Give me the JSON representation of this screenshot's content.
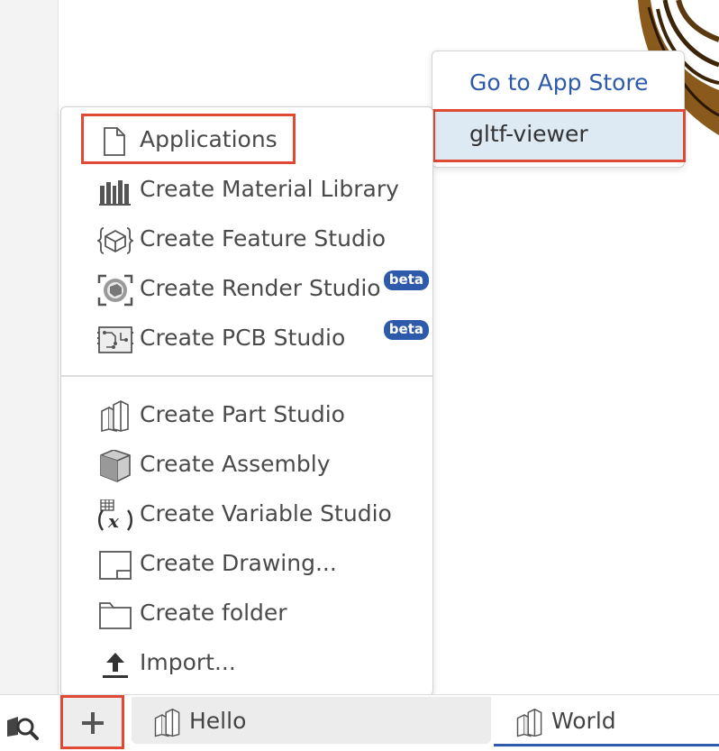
{
  "insert_menu": {
    "items": [
      {
        "label": "Applications",
        "icon": "document-icon",
        "highlighted": true
      },
      {
        "label": "Create Material Library",
        "icon": "material-library-icon"
      },
      {
        "label": "Create Feature Studio",
        "icon": "feature-studio-icon"
      },
      {
        "label": "Create Render Studio",
        "icon": "render-studio-icon",
        "badge": "beta"
      },
      {
        "label": "Create PCB Studio",
        "icon": "pcb-studio-icon",
        "badge": "beta"
      },
      {
        "label": "Create Part Studio",
        "icon": "part-studio-icon"
      },
      {
        "label": "Create Assembly",
        "icon": "assembly-icon"
      },
      {
        "label": "Create Variable Studio",
        "icon": "variable-studio-icon"
      },
      {
        "label": "Create Drawing...",
        "icon": "drawing-icon"
      },
      {
        "label": "Create folder",
        "icon": "folder-icon"
      },
      {
        "label": "Import...",
        "icon": "upload-icon"
      }
    ]
  },
  "applications_submenu": {
    "store_link": "Go to App Store",
    "apps": [
      {
        "label": "gltf-viewer",
        "highlighted": true
      }
    ]
  },
  "tabbar": {
    "search_icon": "search-tabs-icon",
    "add_icon": "plus-icon",
    "tabs": [
      {
        "label": "Hello",
        "icon": "part-studio-icon",
        "active": false
      },
      {
        "label": "World",
        "icon": "part-studio-icon",
        "active": true
      }
    ]
  },
  "colors": {
    "accent": "#2d5aab",
    "highlight_border": "#e04a35",
    "selected_bg": "#dde9f3"
  }
}
